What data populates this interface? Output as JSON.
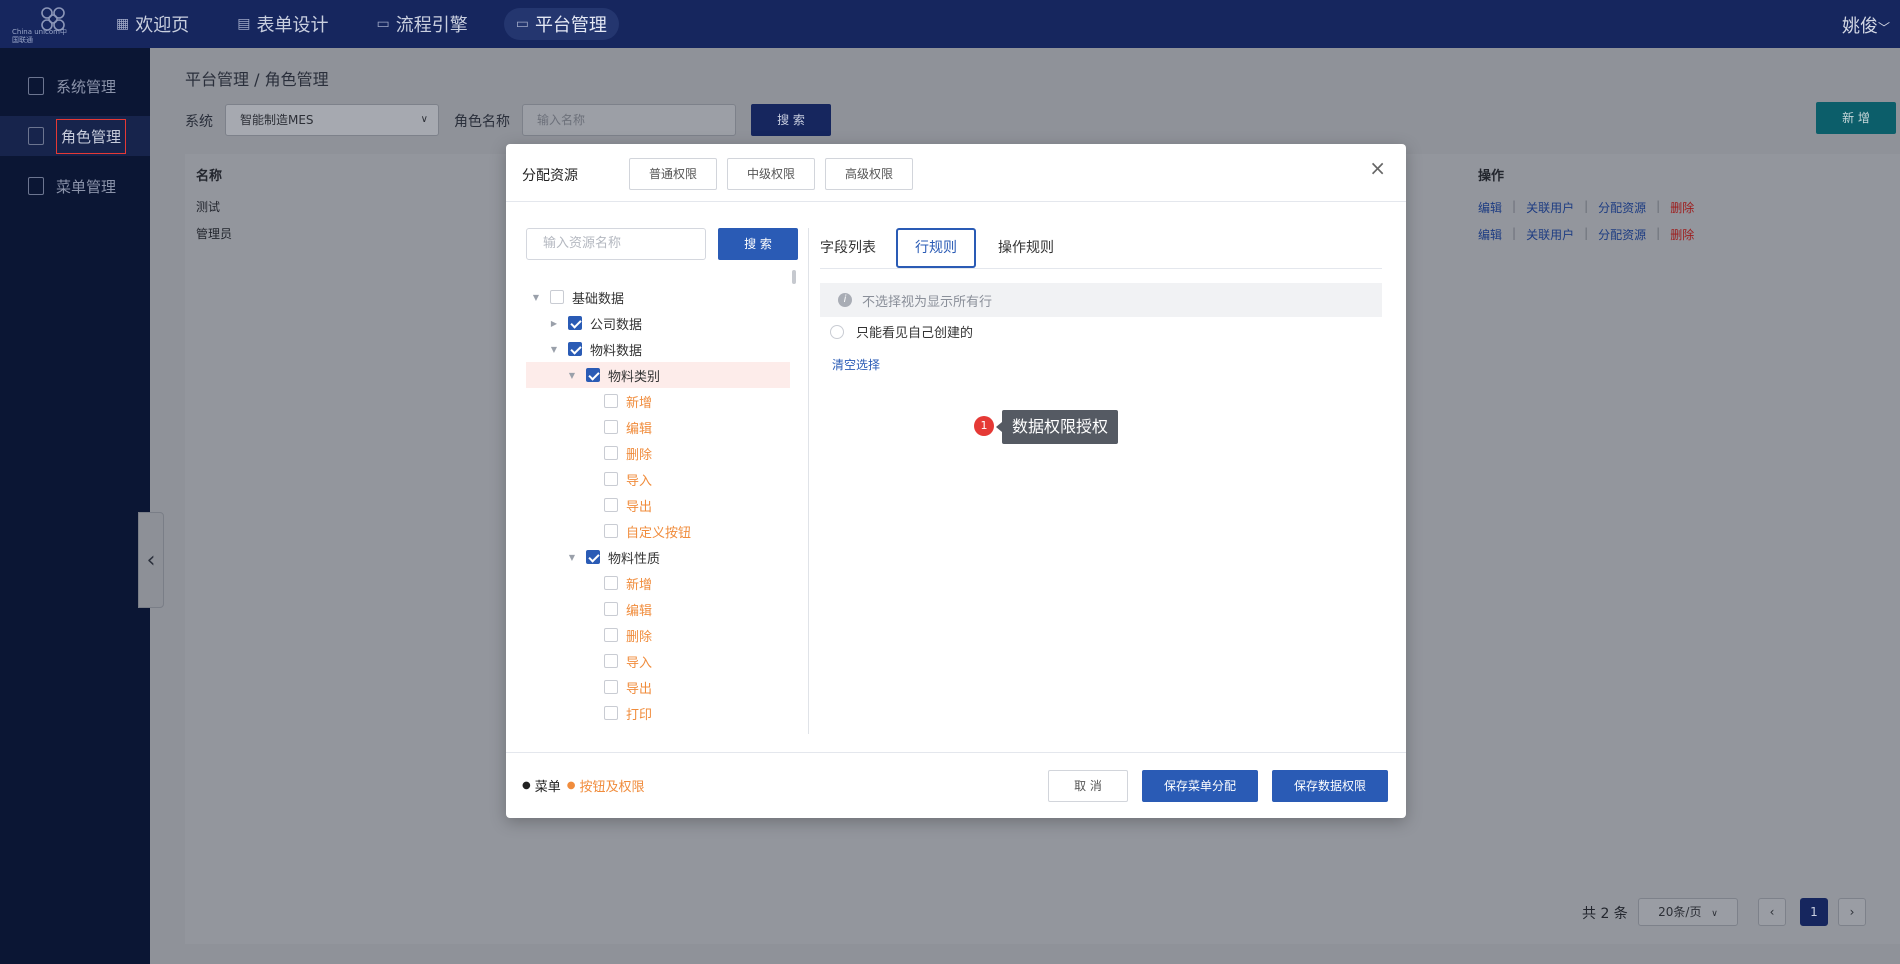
{
  "topbar": {
    "logo_caption": "China unicom中国联通",
    "nav": [
      {
        "label": "欢迎页",
        "icon": "grid-icon"
      },
      {
        "label": "表单设计",
        "icon": "form-icon"
      },
      {
        "label": "流程引擎",
        "icon": "flow-icon"
      },
      {
        "label": "平台管理",
        "icon": "monitor-icon"
      }
    ],
    "user_name": "姚俊",
    "user_caret": "﹀"
  },
  "sidebar": {
    "items": [
      {
        "label": "系统管理",
        "icon": "system-icon"
      },
      {
        "label": "角色管理",
        "icon": "role-icon"
      },
      {
        "label": "菜单管理",
        "icon": "menu-icon"
      }
    ]
  },
  "page": {
    "breadcrumb": "平台管理  /  角色管理",
    "filters": {
      "system_label": "系统",
      "system_value": "智能制造MES",
      "role_label": "角色名称",
      "role_placeholder": "输入名称",
      "search_button": "搜 索",
      "add_button": "新 增"
    },
    "table": {
      "headers": {
        "name": "名称",
        "ops": "操作"
      },
      "rows": [
        {
          "name": "测试"
        },
        {
          "name": "管理员"
        }
      ],
      "ops": {
        "edit": "编辑",
        "users": "关联用户",
        "assign": "分配资源",
        "delete": "删除",
        "sep": "|"
      }
    },
    "pager": {
      "total": "共 2 条",
      "size": "20条/页",
      "current": "1",
      "prev": "‹",
      "next": "›"
    },
    "collapse_glyph": "‹"
  },
  "modal": {
    "title": "分配资源",
    "perm_tabs": [
      "普通权限",
      "中级权限",
      "高级权限"
    ],
    "close_glyph": "×",
    "resource_placeholder": "输入资源名称",
    "search_button": "搜 索",
    "tree": [
      {
        "label": "基础数据",
        "level": 0,
        "arrow": "down",
        "checked": false,
        "orange": false
      },
      {
        "label": "公司数据",
        "level": 1,
        "arrow": "right",
        "checked": true,
        "orange": false
      },
      {
        "label": "物料数据",
        "level": 1,
        "arrow": "down",
        "checked": true,
        "orange": false
      },
      {
        "label": "物料类别",
        "level": 2,
        "arrow": "down",
        "checked": true,
        "orange": false,
        "highlight": true
      },
      {
        "label": "新增",
        "level": 3,
        "arrow": "",
        "checked": false,
        "orange": true
      },
      {
        "label": "编辑",
        "level": 3,
        "arrow": "",
        "checked": false,
        "orange": true
      },
      {
        "label": "删除",
        "level": 3,
        "arrow": "",
        "checked": false,
        "orange": true
      },
      {
        "label": "导入",
        "level": 3,
        "arrow": "",
        "checked": false,
        "orange": true
      },
      {
        "label": "导出",
        "level": 3,
        "arrow": "",
        "checked": false,
        "orange": true
      },
      {
        "label": "自定义按钮",
        "level": 3,
        "arrow": "",
        "checked": false,
        "orange": true
      },
      {
        "label": "物料性质",
        "level": 2,
        "arrow": "down",
        "checked": true,
        "orange": false
      },
      {
        "label": "新增",
        "level": 3,
        "arrow": "",
        "checked": false,
        "orange": true
      },
      {
        "label": "编辑",
        "level": 3,
        "arrow": "",
        "checked": false,
        "orange": true
      },
      {
        "label": "删除",
        "level": 3,
        "arrow": "",
        "checked": false,
        "orange": true
      },
      {
        "label": "导入",
        "level": 3,
        "arrow": "",
        "checked": false,
        "orange": true
      },
      {
        "label": "导出",
        "level": 3,
        "arrow": "",
        "checked": false,
        "orange": true
      },
      {
        "label": "打印",
        "level": 3,
        "arrow": "",
        "checked": false,
        "orange": true
      }
    ],
    "right_tabs": {
      "fields": "字段列表",
      "rows": "行规则",
      "ops": "操作规则"
    },
    "info_icon": "i",
    "info_text": "不选择视为显示所有行",
    "radio_option": "只能看见自己创建的",
    "clear_link": "清空选择",
    "hint_badge": "1",
    "hint_text": "数据权限授权",
    "legend": {
      "menu_dot": "●",
      "menu": "菜单",
      "button_dot": "●",
      "buttons": "按钮及权限"
    },
    "footer": {
      "cancel": "取 消",
      "save_menu": "保存菜单分配",
      "save_data": "保存数据权限"
    }
  },
  "colors": {
    "nav_bg": "#16265e",
    "sidebar_bg": "#0b1634",
    "primary": "#2a5bb5",
    "accent_orange": "#f08c3c",
    "danger": "#e53935"
  }
}
